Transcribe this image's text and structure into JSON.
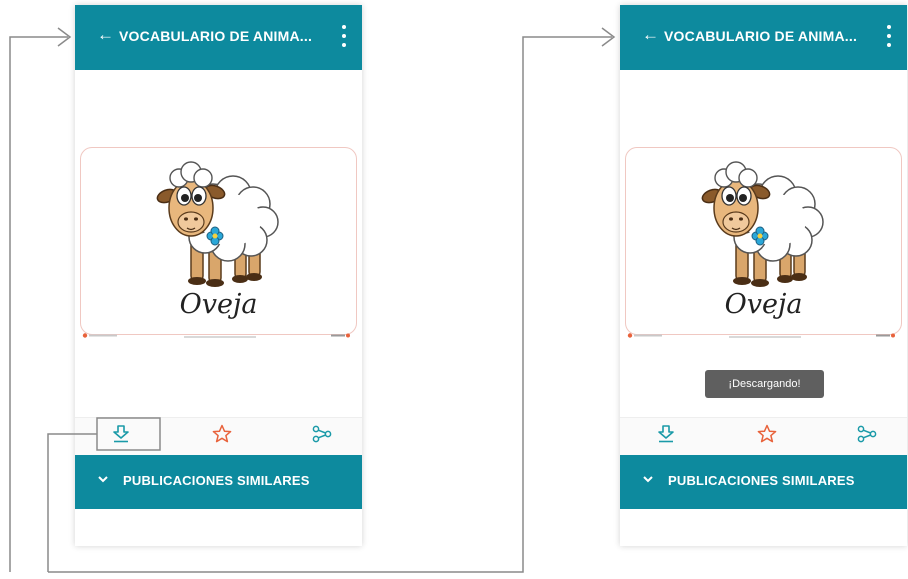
{
  "screens": [
    {
      "app_bar": {
        "back_icon": "arrow-left-icon",
        "title": "VOCABULARIO DE ANIMA...",
        "menu_icon": "more-vert-icon"
      },
      "card": {
        "image": "sheep-illustration",
        "word": "Oveja"
      },
      "actions": {
        "download_icon": "download-icon",
        "favorite_icon": "star-icon",
        "share_icon": "share-icon"
      },
      "similar": {
        "chevron_icon": "chevron-down-icon",
        "label": "PUBLICACIONES SIMILARES"
      }
    },
    {
      "app_bar": {
        "back_icon": "arrow-left-icon",
        "title": "VOCABULARIO DE ANIMA...",
        "menu_icon": "more-vert-icon"
      },
      "card": {
        "image": "sheep-illustration",
        "word": "Oveja"
      },
      "toast": "¡Descargando!",
      "actions": {
        "download_icon": "download-icon",
        "favorite_icon": "star-icon",
        "share_icon": "share-icon"
      },
      "similar": {
        "chevron_icon": "chevron-down-icon",
        "label": "PUBLICACIONES SIMILARES"
      }
    }
  ],
  "colors": {
    "primary": "#0d8a9e",
    "accent_star": "#e8623b",
    "highlight_border": "#888888",
    "toast_bg": "#5f5f5f",
    "card_border": "#f0c8c2"
  }
}
